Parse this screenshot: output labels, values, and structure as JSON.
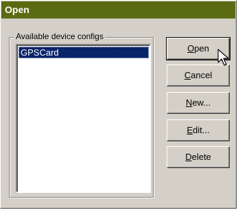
{
  "window": {
    "title": "Open"
  },
  "group": {
    "label": "Available device configs"
  },
  "list": {
    "items": [
      "GPSCard"
    ],
    "selected_index": 0
  },
  "buttons": {
    "open": {
      "mnemonic": "O",
      "rest": "pen"
    },
    "cancel": {
      "mnemonic": "C",
      "rest": "ancel"
    },
    "new": {
      "mnemonic": "N",
      "rest": "ew..."
    },
    "edit": {
      "mnemonic": "E",
      "rest": "dit..."
    },
    "delete": {
      "mnemonic": "D",
      "rest": "elete"
    }
  },
  "colors": {
    "titlebar": "#5a6b12",
    "selection": "#0a246a",
    "face": "#d4d0c8"
  },
  "cursor": {
    "icon": "arrow-cursor-icon"
  }
}
